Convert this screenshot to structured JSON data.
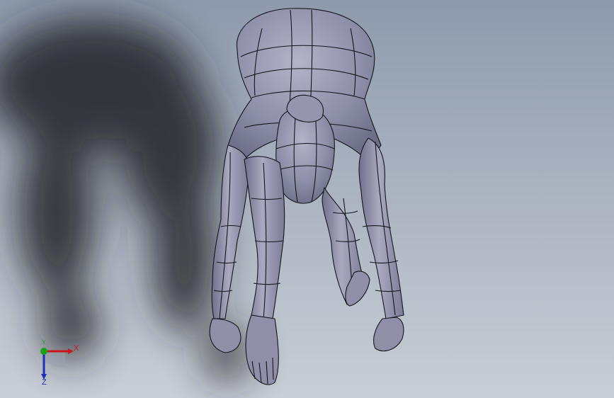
{
  "viewport": {
    "background_top": "#8e9aac",
    "background_bottom": "#c9ced6",
    "model_fill": "#8a8ba3",
    "model_edge": "#15151c",
    "shadow_color": "#222428"
  },
  "triad": {
    "x_label": "X",
    "y_label": "Y",
    "z_label": "Z",
    "x_color": "#c8161d",
    "y_color": "#1aa31a",
    "z_color": "#1d2fb8"
  }
}
